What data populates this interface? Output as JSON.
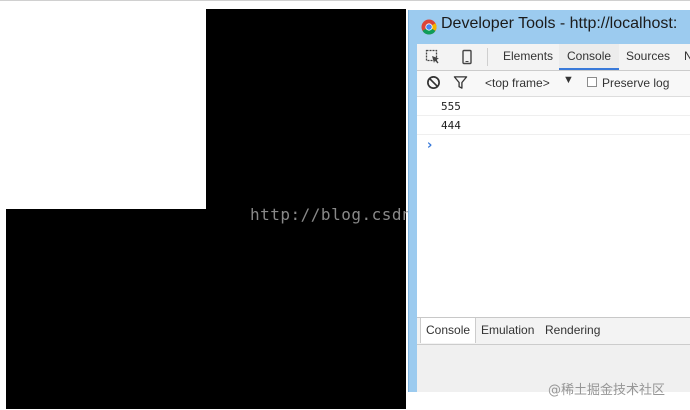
{
  "page": {
    "watermark_url": "http://blog.csdn.net/",
    "watermark_credit": "@稀土掘金技术社区"
  },
  "devtools": {
    "title": "Developer Tools - http://localhost:",
    "panel_tabs": [
      "Elements",
      "Console",
      "Sources",
      "Ne"
    ],
    "active_panel": "Console",
    "toolbar": {
      "frame_selector": "<top frame>",
      "preserve_log_label": "Preserve log",
      "preserve_log_checked": false
    },
    "console_output": [
      "555",
      "444"
    ],
    "prompt_glyph": "›",
    "drawer_tabs": [
      "Console",
      "Emulation",
      "Rendering"
    ],
    "active_drawer": "Console"
  },
  "colors": {
    "window_frame": "#9ccbef",
    "active_tab_accent": "#3879d9",
    "block_fill": "#000000"
  },
  "icons": [
    "chrome-icon",
    "inspect-element-icon",
    "device-mode-icon",
    "clear-console-icon",
    "filter-icon",
    "dropdown-arrow-icon",
    "prompt-caret-icon"
  ]
}
